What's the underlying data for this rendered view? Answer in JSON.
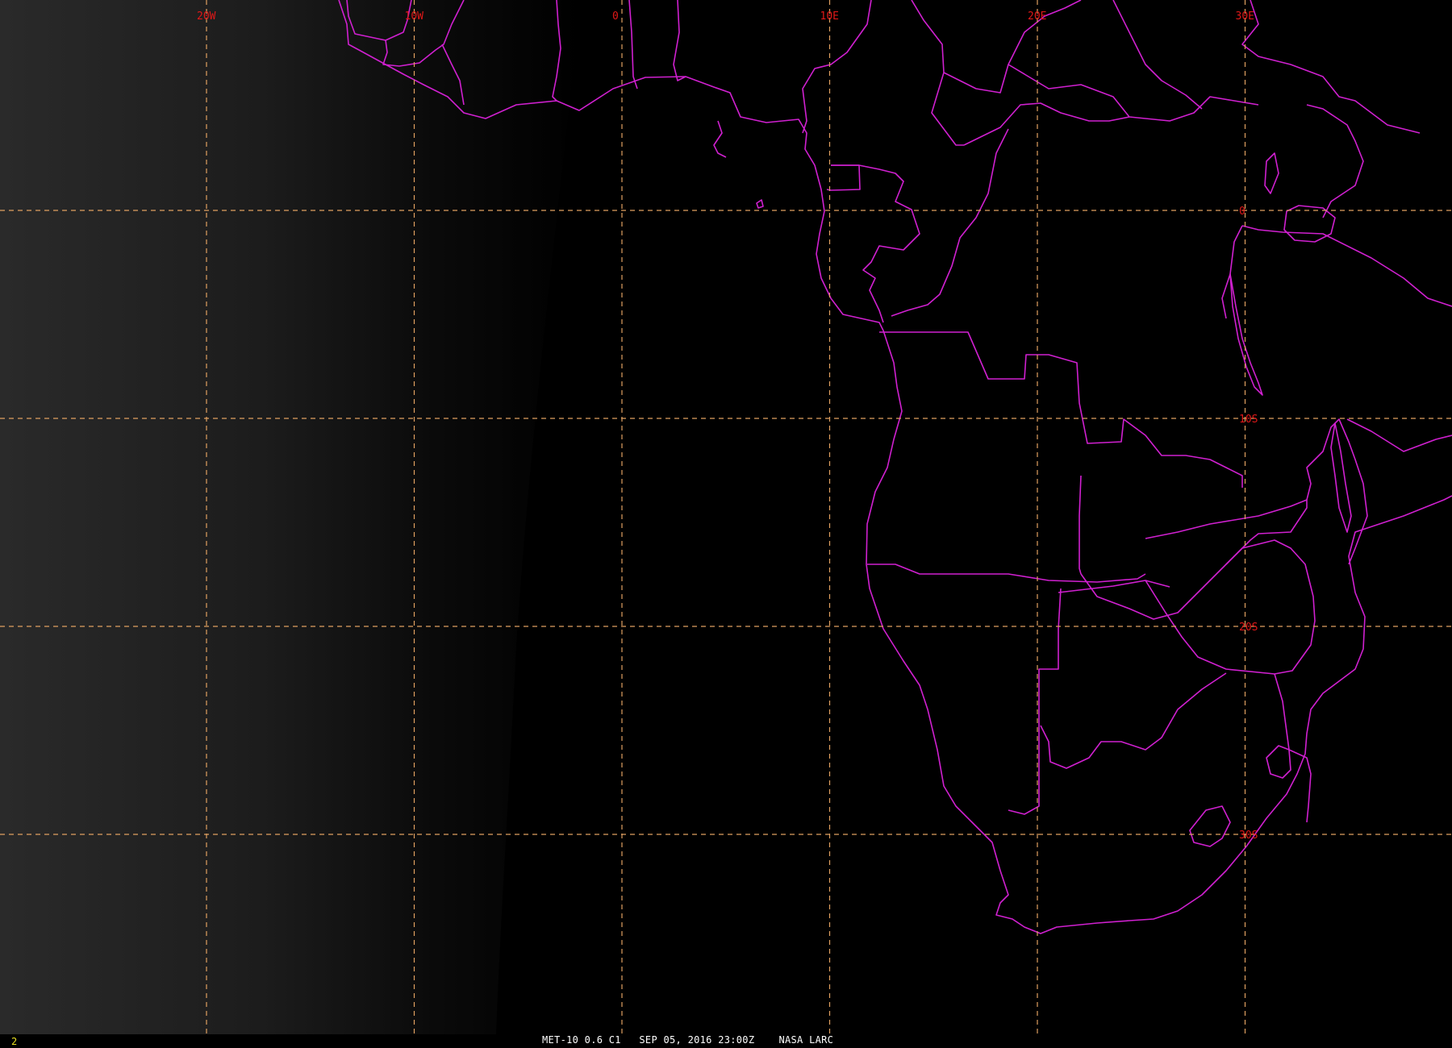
{
  "image": {
    "product": "MET-10 0.6 C1",
    "caption": "MET-10 0.6 C1   SEP 05, 2016 23:00Z    NASA LARC",
    "frame_number": "2",
    "background": "#000000",
    "border_color": "#d020d0",
    "grid_color": "#e0a060",
    "label_color": "#e01818",
    "frame_number_color": "#e8e020"
  },
  "grid": {
    "longitudes": [
      {
        "label": "20W",
        "lon": -20
      },
      {
        "label": "10W",
        "lon": -10
      },
      {
        "label": "0",
        "lon": 0
      },
      {
        "label": "10E",
        "lon": 10
      },
      {
        "label": "20E",
        "lon": 20
      },
      {
        "label": "30E",
        "lon": 30
      }
    ],
    "latitudes": [
      {
        "label": "0",
        "lat": 0
      },
      {
        "label": "10S",
        "lat": -10
      },
      {
        "label": "20S",
        "lat": -20
      },
      {
        "label": "30S",
        "lat": -30
      }
    ]
  }
}
